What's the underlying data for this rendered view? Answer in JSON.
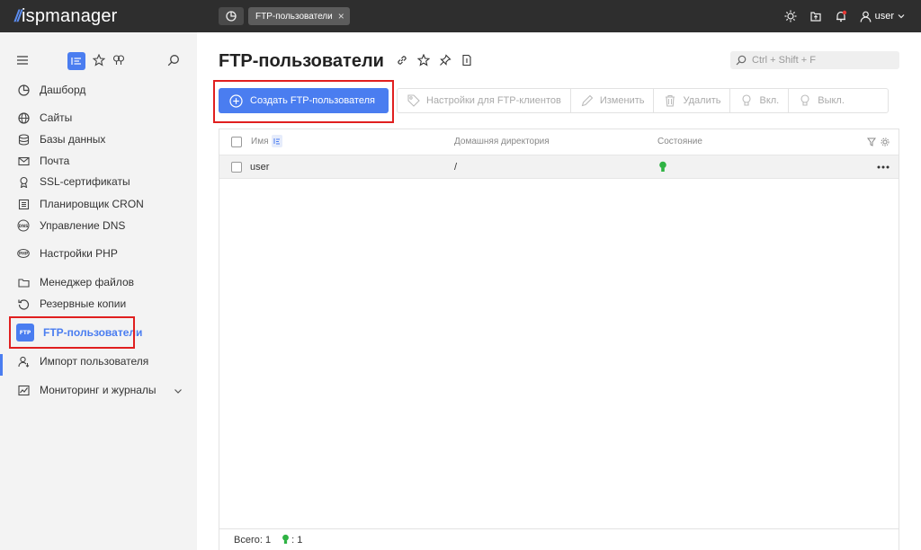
{
  "app": {
    "logo_text": "ispmanager",
    "logo_mark": "//"
  },
  "topbar": {
    "tab_label": "FTP-пользователи",
    "tab_close": "×",
    "user_label": "user"
  },
  "sidebar": {
    "items": [
      {
        "label": "Дашборд",
        "icon": "dashboard-icon"
      },
      {
        "label": "Сайты",
        "icon": "globe-icon"
      },
      {
        "label": "Базы данных",
        "icon": "database-icon"
      },
      {
        "label": "Почта",
        "icon": "mail-icon"
      },
      {
        "label": "SSL-сертификаты",
        "icon": "certificate-icon"
      },
      {
        "label": "Планировщик CRON",
        "icon": "calendar-icon"
      },
      {
        "label": "Управление DNS",
        "icon": "dns-icon"
      },
      {
        "label": "Настройки PHP",
        "icon": "php-icon"
      },
      {
        "label": "Менеджер файлов",
        "icon": "folder-icon"
      },
      {
        "label": "Резервные копии",
        "icon": "backup-icon"
      },
      {
        "label": "FTP-пользователи",
        "icon": "ftp-icon"
      },
      {
        "label": "Импорт пользователя",
        "icon": "import-user-icon"
      },
      {
        "label": "Мониторинг и журналы",
        "icon": "monitoring-icon"
      }
    ],
    "active_index": 10,
    "ftp_icon_text": "FTP"
  },
  "main": {
    "title": "FTP-пользователи",
    "search_placeholder": "Ctrl + Shift + F",
    "toolbar": {
      "create": "Создать FTP-пользователя",
      "ftp_settings": "Настройки для FTP-клиентов",
      "edit": "Изменить",
      "delete": "Удалить",
      "enable": "Вкл.",
      "disable": "Выкл."
    },
    "table": {
      "columns": [
        "Имя",
        "Домашняя директория",
        "Состояние"
      ],
      "rows": [
        {
          "name": "user",
          "home": "/",
          "state": "enabled"
        }
      ]
    },
    "footer": {
      "total_label": "Всего: 1",
      "active_count": ": 1"
    }
  },
  "colors": {
    "accent": "#4a7df0",
    "highlight": "#e01f1f",
    "topbar": "#2e2e2e",
    "status_on": "#2fb344"
  }
}
